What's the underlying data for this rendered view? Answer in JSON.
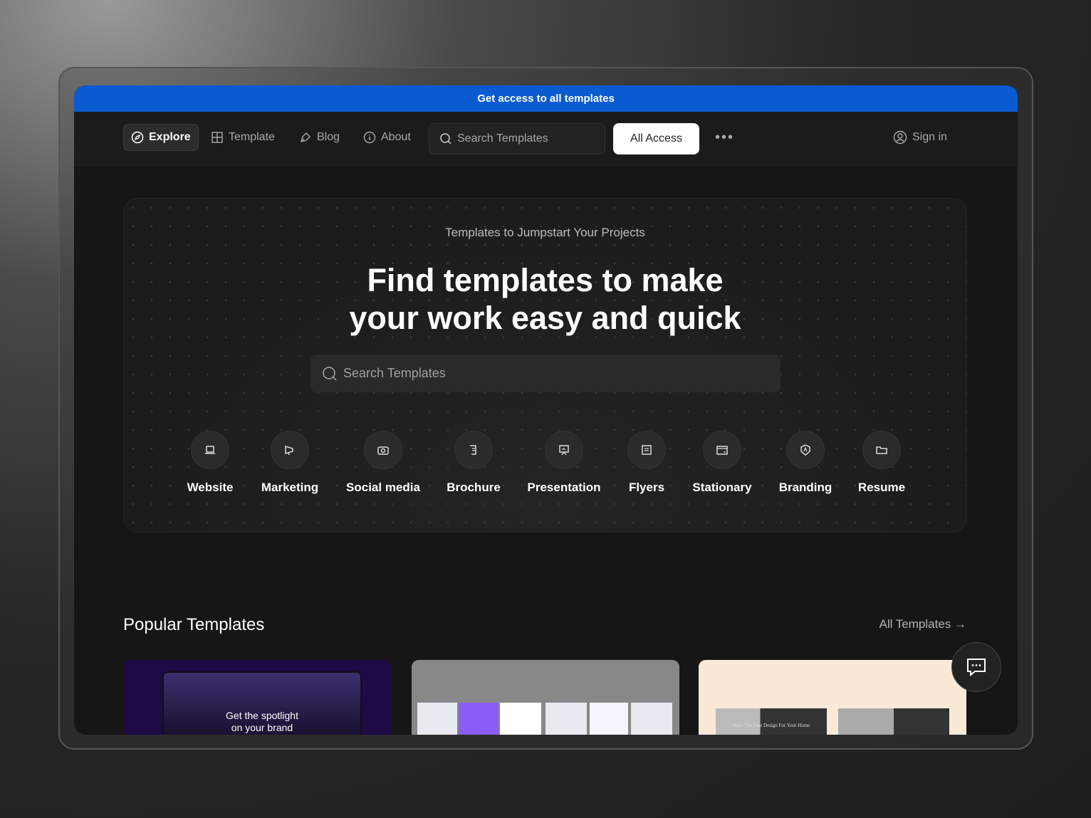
{
  "banner": {
    "text": "Get access to all templates",
    "color": "#0a5bd1"
  },
  "nav": {
    "explore": "Explore",
    "template": "Template",
    "blog": "Blog",
    "about": "About",
    "search_placeholder": "Search Templates",
    "all_access": "All Access",
    "more": "•••",
    "sign_in": "Sign in"
  },
  "hero": {
    "kicker": "Templates to Jumpstart Your Projects",
    "title_line1": "Find templates to make",
    "title_line2": "your work easy and quick",
    "search_placeholder": "Search Templates"
  },
  "categories": [
    {
      "label": "Website",
      "icon": "laptop-icon"
    },
    {
      "label": "Marketing",
      "icon": "megaphone-icon"
    },
    {
      "label": "Social media",
      "icon": "camera-icon"
    },
    {
      "label": "Brochure",
      "icon": "scroll-icon"
    },
    {
      "label": "Presentation",
      "icon": "presentation-icon"
    },
    {
      "label": "Flyers",
      "icon": "document-icon"
    },
    {
      "label": "Stationary",
      "icon": "card-icon"
    },
    {
      "label": "Branding",
      "icon": "badge-icon"
    },
    {
      "label": "Resume",
      "icon": "folder-icon"
    }
  ],
  "popular": {
    "title": "Popular Templates",
    "all_link": "All Templates →",
    "cards": [
      {
        "text1": "Get the spotlight",
        "text2": "on your brand"
      },
      {
        "text1": ""
      },
      {
        "text1": "Have The Best Design For Your Home"
      }
    ]
  }
}
